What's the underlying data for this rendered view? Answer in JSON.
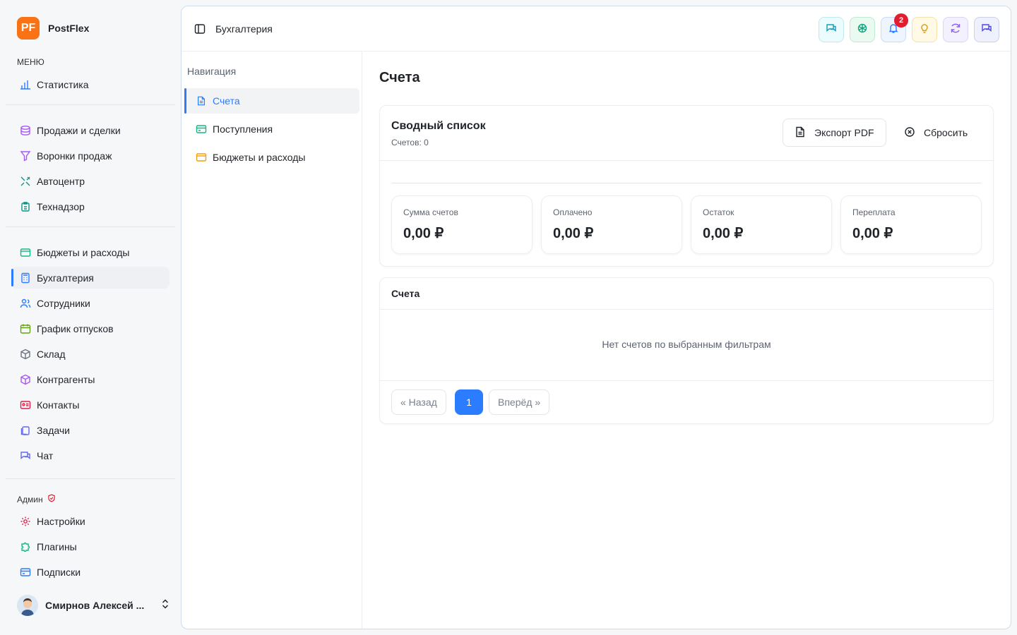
{
  "brand": {
    "logo_text": "PF",
    "name": "PostFlex",
    "color": "#f97316"
  },
  "sidebar": {
    "menu_label": "МЕНЮ",
    "admin_label": "Админ",
    "items": [
      {
        "label": "Статистика",
        "icon": "bar-chart-icon",
        "color": "#2b7cff"
      },
      {
        "label": "Продажи и сделки",
        "icon": "coins-icon",
        "color": "#a855f7"
      },
      {
        "label": "Воронки продаж",
        "icon": "funnel-icon",
        "color": "#a855f7"
      },
      {
        "label": "Автоцентр",
        "icon": "wrench-icon",
        "color": "#0d9488"
      },
      {
        "label": "Технадзор",
        "icon": "clipboard-icon",
        "color": "#0d9488"
      },
      {
        "label": "Бюджеты и расходы",
        "icon": "wallet-icon",
        "color": "#10b981"
      },
      {
        "label": "Бухгалтерия",
        "icon": "calculator-icon",
        "color": "#2b7cff"
      },
      {
        "label": "Сотрудники",
        "icon": "users-icon",
        "color": "#2b7cff"
      },
      {
        "label": "График отпусков",
        "icon": "calendar-icon",
        "color": "#65a30d"
      },
      {
        "label": "Склад",
        "icon": "box-icon",
        "color": "#6b7280"
      },
      {
        "label": "Контрагенты",
        "icon": "package-icon",
        "color": "#a855f7"
      },
      {
        "label": "Контакты",
        "icon": "contact-card-icon",
        "color": "#e11d48"
      },
      {
        "label": "Задачи",
        "icon": "tasks-icon",
        "color": "#6366f1"
      },
      {
        "label": "Чат",
        "icon": "chat-icon",
        "color": "#6366f1"
      },
      {
        "label": "Настройки",
        "icon": "gear-icon",
        "color": "#e11d48"
      },
      {
        "label": "Плагины",
        "icon": "puzzle-icon",
        "color": "#10b981"
      },
      {
        "label": "Подписки",
        "icon": "credit-card-icon",
        "color": "#2b7cff"
      }
    ],
    "active": "Бухгалтерия",
    "user_name": "Смирнов Алексей ..."
  },
  "topbar": {
    "title": "Бухгалтерия",
    "notification_count": "2"
  },
  "subnav": {
    "label": "Навигация",
    "items": [
      {
        "label": "Счета",
        "icon": "document-icon"
      },
      {
        "label": "Поступления",
        "icon": "credit-card-icon"
      },
      {
        "label": "Бюджеты и расходы",
        "icon": "wallet-icon"
      }
    ]
  },
  "main": {
    "page_title": "Счета",
    "summary": {
      "title": "Сводный список",
      "count_text": "Счетов: 0",
      "export_label": "Экспорт PDF",
      "reset_label": "Сбросить",
      "stats": [
        {
          "label": "Сумма счетов",
          "value": "0,00 ₽"
        },
        {
          "label": "Оплачено",
          "value": "0,00 ₽"
        },
        {
          "label": "Остаток",
          "value": "0,00 ₽"
        },
        {
          "label": "Переплата",
          "value": "0,00 ₽"
        }
      ]
    },
    "invoices": {
      "title": "Счета",
      "empty_text": "Нет счетов по выбранным фильтрам",
      "prev_label": "« Назад",
      "current_page": "1",
      "next_label": "Вперёд »"
    }
  },
  "colors": {
    "accent": "#2b7cff",
    "badge": "#e11d2e"
  }
}
